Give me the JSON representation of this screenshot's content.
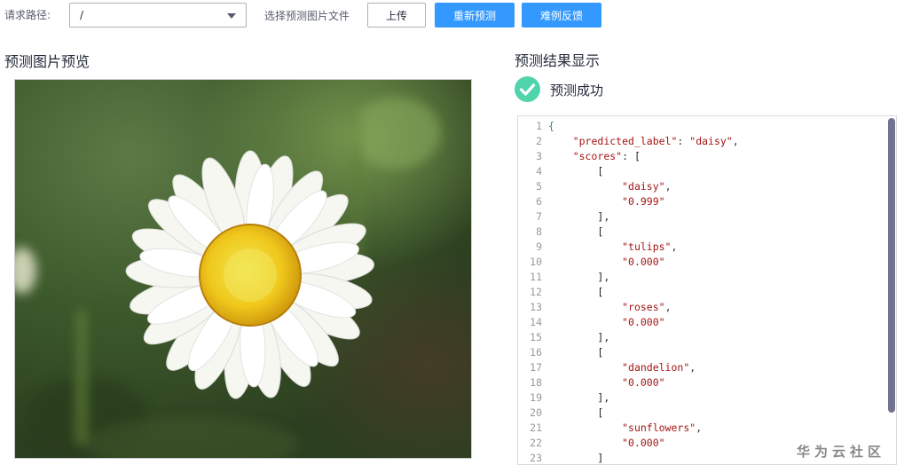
{
  "toolbar": {
    "path_label": "请求路径:",
    "path_value": "/",
    "file_label": "选择预测图片文件",
    "upload_label": "上传",
    "repredict_label": "重新预测",
    "feedback_label": "难例反馈"
  },
  "preview": {
    "title": "预测图片预览"
  },
  "result": {
    "title": "预测结果显示",
    "status": "预测成功",
    "json_lines": [
      {
        "n": "1",
        "t": "{"
      },
      {
        "n": "2",
        "t": "    \"predicted_label\": \"daisy\","
      },
      {
        "n": "3",
        "t": "    \"scores\": ["
      },
      {
        "n": "4",
        "t": "        ["
      },
      {
        "n": "5",
        "t": "            \"daisy\","
      },
      {
        "n": "6",
        "t": "            \"0.999\""
      },
      {
        "n": "7",
        "t": "        ],"
      },
      {
        "n": "8",
        "t": "        ["
      },
      {
        "n": "9",
        "t": "            \"tulips\","
      },
      {
        "n": "10",
        "t": "            \"0.000\""
      },
      {
        "n": "11",
        "t": "        ],"
      },
      {
        "n": "12",
        "t": "        ["
      },
      {
        "n": "13",
        "t": "            \"roses\","
      },
      {
        "n": "14",
        "t": "            \"0.000\""
      },
      {
        "n": "15",
        "t": "        ],"
      },
      {
        "n": "16",
        "t": "        ["
      },
      {
        "n": "17",
        "t": "            \"dandelion\","
      },
      {
        "n": "18",
        "t": "            \"0.000\""
      },
      {
        "n": "19",
        "t": "        ],"
      },
      {
        "n": "20",
        "t": "        ["
      },
      {
        "n": "21",
        "t": "            \"sunflowers\","
      },
      {
        "n": "22",
        "t": "            \"0.000\""
      },
      {
        "n": "23",
        "t": "        ]"
      }
    ]
  },
  "watermark": "华为云社区",
  "colors": {
    "primary_button": "#3399ff",
    "success": "#50d4ab",
    "json_string": "#a31515",
    "scrollbar": "#73738f"
  },
  "icons": {
    "path_dropdown": "chevron-down-icon",
    "success": "check-circle-icon"
  }
}
